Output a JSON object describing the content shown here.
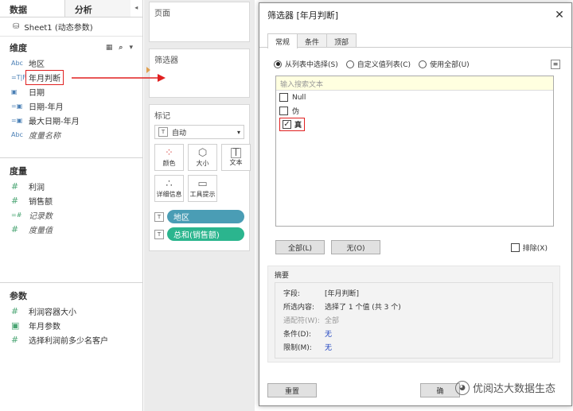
{
  "left": {
    "tabs": [
      "数据",
      "分析"
    ],
    "tab_arrow": "◂",
    "source": "Sheet1 (动态参数)",
    "dimensions": {
      "title": "维度",
      "items": [
        {
          "icon": "Abc",
          "label": "地区",
          "italic": false
        },
        {
          "icon": "=T|F",
          "label": "年月判断",
          "italic": false,
          "highlight": true
        },
        {
          "icon": "📅",
          "label": "日期",
          "italic": false
        },
        {
          "icon": "=📅",
          "label": "日期-年月",
          "italic": false
        },
        {
          "icon": "=📅",
          "label": "最大日期-年月",
          "italic": false
        },
        {
          "icon": "Abc",
          "label": "度量名称",
          "italic": true
        }
      ]
    },
    "measures": {
      "title": "度量",
      "items": [
        {
          "icon": "#",
          "label": "利润",
          "italic": false
        },
        {
          "icon": "#",
          "label": "销售额",
          "italic": false
        },
        {
          "icon": "=#",
          "label": "记录数",
          "italic": true
        },
        {
          "icon": "#",
          "label": "度量值",
          "italic": true
        }
      ]
    },
    "parameters": {
      "title": "参数",
      "items": [
        {
          "icon": "#",
          "label": "利润容器大小"
        },
        {
          "icon": "📅",
          "label": "年月参数"
        },
        {
          "icon": "#",
          "label": "选择利润前多少名客户"
        }
      ]
    }
  },
  "mid": {
    "pages_title": "页面",
    "filters_title": "筛选器",
    "marks_title": "标记",
    "marks_type": "自动",
    "mark_buttons": [
      {
        "icon": "palette-icon",
        "glyph": "⁘",
        "label": "颜色"
      },
      {
        "icon": "size-icon",
        "glyph": "⬡",
        "label": "大小"
      },
      {
        "icon": "text-icon",
        "glyph": "T",
        "label": "文本"
      },
      {
        "icon": "detail-icon",
        "glyph": "∴",
        "label": "详细信息"
      },
      {
        "icon": "tooltip-icon",
        "glyph": "▭",
        "label": "工具提示"
      }
    ],
    "pills": [
      {
        "label": "地区",
        "color": "#4a9db5"
      },
      {
        "label": "总和(销售额)",
        "color": "#2bb58e"
      }
    ]
  },
  "dialog": {
    "title": "筛选器 [年月判断]",
    "close": "✕",
    "tabs": [
      "常规",
      "条件",
      "顶部"
    ],
    "radios": [
      {
        "label": "从列表中选择(S)",
        "selected": true
      },
      {
        "label": "自定义值列表(C)",
        "selected": false
      },
      {
        "label": "使用全部(U)",
        "selected": false
      }
    ],
    "search_placeholder": "输入搜索文本",
    "values": [
      {
        "label": "Null",
        "checked": false
      },
      {
        "label": "伪",
        "checked": false
      },
      {
        "label": "真",
        "checked": true
      }
    ],
    "btn_all": "全部(L)",
    "btn_none": "无(O)",
    "exclude_label": "排除(X)",
    "summary": {
      "title": "摘要",
      "rows": [
        {
          "key": "字段:",
          "value": "[年月判断]",
          "dim": false,
          "blue": false
        },
        {
          "key": "所选内容:",
          "value": "选择了 1 个值 (共 3 个)",
          "dim": false,
          "blue": false
        },
        {
          "key": "通配符(W):",
          "value": "全部",
          "dim": true,
          "blue": false
        },
        {
          "key": "条件(D):",
          "value": "无",
          "dim": false,
          "blue": true
        },
        {
          "key": "限制(M):",
          "value": "无",
          "dim": false,
          "blue": true
        }
      ]
    },
    "btn_reset": "重置",
    "btn_ok": "确"
  },
  "watermark": "优阅达大数据生态",
  "colors": {
    "highlight": "#e02020",
    "arrow": "#e02020"
  }
}
